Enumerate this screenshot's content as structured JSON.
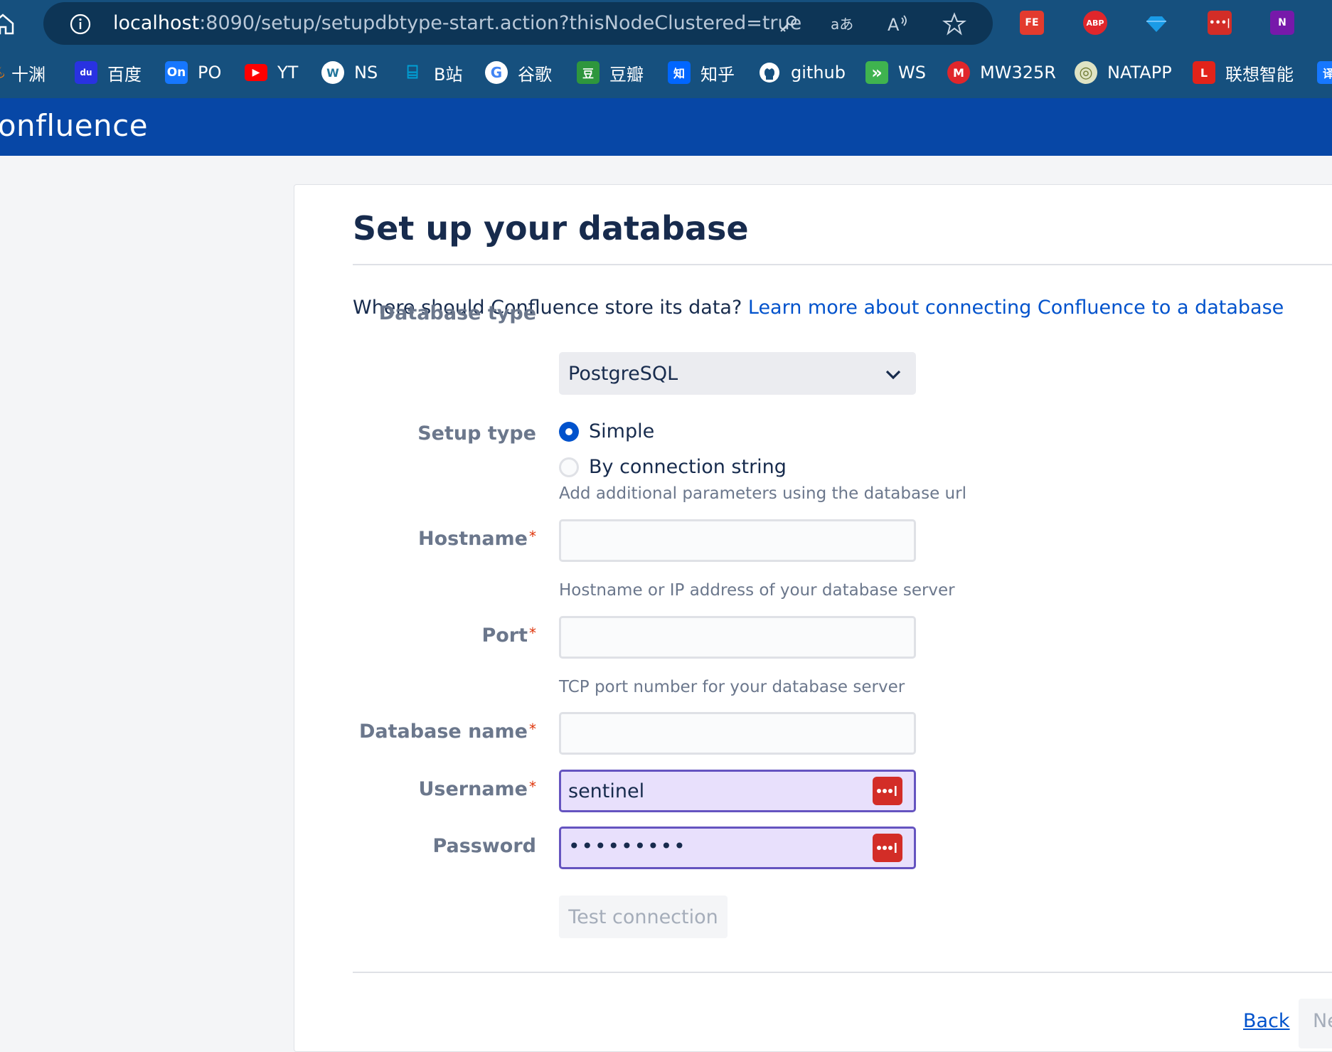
{
  "browser": {
    "url_host": "localhost",
    "url_path": ":8090/setup/setupdbtype-start.action?thisNodeClustered=true",
    "extensions": [
      {
        "name": "fe-helper",
        "text": "FE",
        "color": "#e33b2e"
      },
      {
        "name": "adblock-plus",
        "text": "ABP",
        "color": "#e0262b"
      },
      {
        "name": "gem",
        "text": "",
        "color": "#1a9be6"
      },
      {
        "name": "lastpass",
        "text": "•••|",
        "color": "#d32d27"
      },
      {
        "name": "onenote",
        "text": "N",
        "color": "#7719aa"
      }
    ],
    "bookmarks": [
      {
        "label": "十渊",
        "icon": "fire-icon",
        "color": "#ff7a00",
        "text": ""
      },
      {
        "label": "百度",
        "icon": "baidu-icon",
        "color": "#2932e1",
        "text": "du"
      },
      {
        "label": "PO",
        "icon": "on-icon",
        "color": "#1677ff",
        "text": "On"
      },
      {
        "label": "YT",
        "icon": "youtube-icon",
        "color": "#ff0000",
        "text": "▶"
      },
      {
        "label": "NS",
        "icon": "wordpress-icon",
        "color": "#ffffff",
        "text": "W"
      },
      {
        "label": "B站",
        "icon": "bilibili-icon",
        "color": "#00a1d6",
        "text": "⌸"
      },
      {
        "label": "谷歌",
        "icon": "google-icon",
        "color": "#ffffff",
        "text": "G"
      },
      {
        "label": "豆瓣",
        "icon": "douban-icon",
        "color": "#2e963d",
        "text": "豆"
      },
      {
        "label": "知乎",
        "icon": "zhihu-icon",
        "color": "#0066ff",
        "text": "知"
      },
      {
        "label": "github",
        "icon": "github-icon",
        "color": "#ffffff",
        "text": "●"
      },
      {
        "label": "WS",
        "icon": "ws-icon",
        "color": "#3fb34f",
        "text": "»"
      },
      {
        "label": "MW325R",
        "icon": "mercury-icon",
        "color": "#e0262b",
        "text": "M"
      },
      {
        "label": "NATAPP",
        "icon": "natapp-icon",
        "color": "#9aa35b",
        "text": "◎"
      },
      {
        "label": "联想智能",
        "icon": "lenovo-icon",
        "color": "#e2231a",
        "text": "L"
      },
      {
        "label": "",
        "icon": "translate-icon",
        "color": "#1677ff",
        "text": "译"
      }
    ]
  },
  "app": {
    "title": "Confluence"
  },
  "page": {
    "title": "Set up your database",
    "intro_text": "Where should Confluence store its data? ",
    "intro_link": "Learn more about connecting Confluence to a database"
  },
  "form": {
    "database_type": {
      "label": "Database type",
      "value": "PostgreSQL"
    },
    "setup_type": {
      "label": "Setup type",
      "options": [
        "Simple",
        "By connection string"
      ],
      "selected": "Simple",
      "help": "Add additional parameters using the database url"
    },
    "hostname": {
      "label": "Hostname",
      "value": "",
      "help": "Hostname or IP address of your database server"
    },
    "port": {
      "label": "Port",
      "value": "",
      "help": "TCP port number for your database server"
    },
    "database_name": {
      "label": "Database name",
      "value": ""
    },
    "username": {
      "label": "Username",
      "value": "sentinel"
    },
    "password": {
      "label": "Password",
      "masked_value": "•••••••••"
    },
    "required_mark": "*"
  },
  "actions": {
    "test_connection": "Test connection",
    "back": "Back",
    "next": "Next"
  },
  "colors": {
    "header_blue": "#0747a6",
    "browser_chrome": "#16507e",
    "link": "#0052cc",
    "autofill_bg": "#e8e0fc",
    "required": "#de350b"
  }
}
